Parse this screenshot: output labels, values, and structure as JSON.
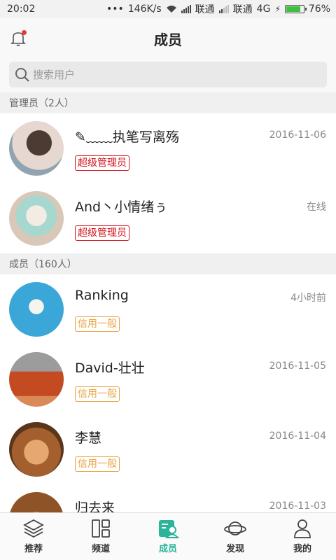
{
  "status": {
    "time": "20:02",
    "dots": "•••",
    "speed": "146K/s",
    "carrier1": "联通",
    "carrier2": "联通",
    "network": "4G",
    "battery": "76%"
  },
  "header": {
    "title": "成员"
  },
  "search": {
    "placeholder": "搜索用户"
  },
  "sections": {
    "admins": "管理员（2人）",
    "members": "成员（160人）"
  },
  "admins": [
    {
      "name": "✎﹏﹏执笔写离殇",
      "time": "2016-11-06",
      "badge": "超级管理员"
    },
    {
      "name": "And丶小情绪ぅ",
      "time": "在线",
      "badge": "超级管理员"
    }
  ],
  "members": [
    {
      "name": "Ranking",
      "time": "4小时前",
      "badge": "信用一般"
    },
    {
      "name": "David-壮壮",
      "time": "2016-11-05",
      "badge": "信用一般"
    },
    {
      "name": "李慧",
      "time": "2016-11-04",
      "badge": "信用一般"
    },
    {
      "name": "归去来",
      "time": "2016-11-03",
      "badge": ""
    }
  ],
  "tabs": [
    {
      "label": "推荐",
      "icon": "layers-icon"
    },
    {
      "label": "频道",
      "icon": "grid-icon"
    },
    {
      "label": "成员",
      "icon": "members-icon",
      "active": true
    },
    {
      "label": "发现",
      "icon": "planet-icon"
    },
    {
      "label": "我的",
      "icon": "person-icon"
    }
  ],
  "colors": {
    "accent": "#2bb49a",
    "admin_badge": "#d2161e",
    "credit_badge": "#e8a444",
    "notification_dot": "#e23a3a"
  }
}
